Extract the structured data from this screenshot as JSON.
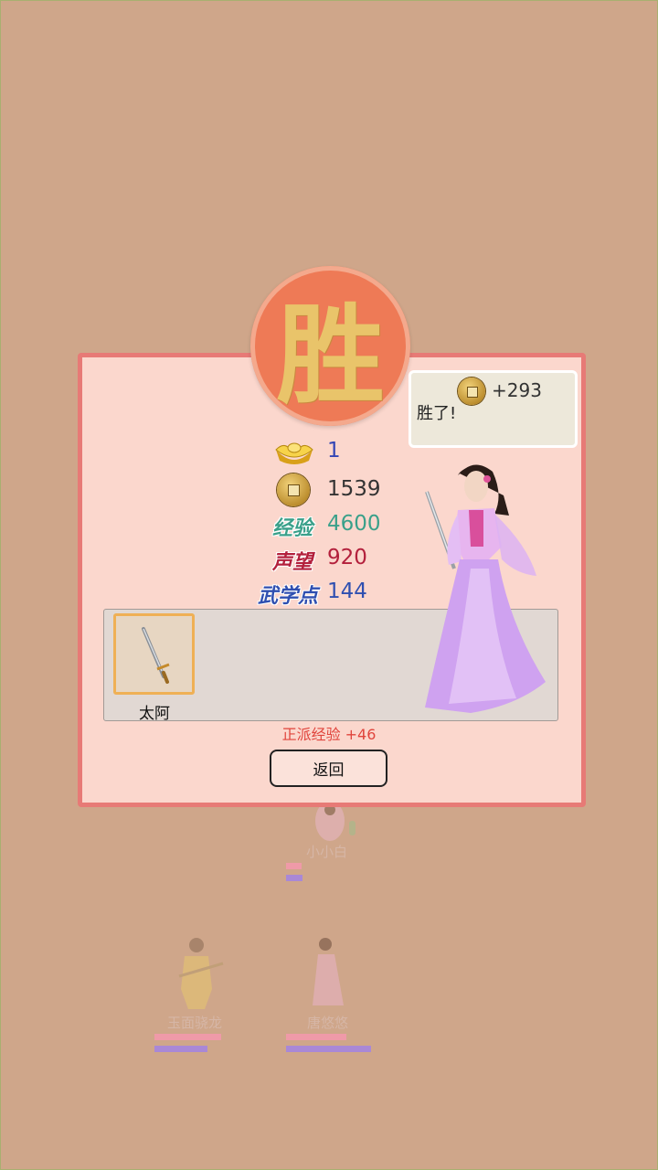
{
  "background_team": [
    {
      "name": "小小白"
    },
    {
      "name": "玉面骁龙"
    },
    {
      "name": "唐悠悠"
    }
  ],
  "result": {
    "badge": "胜",
    "bubble": {
      "coin_gain": "+293",
      "text": "胜了!"
    },
    "ingot_value": "1",
    "coins_value": "1539",
    "exp_label": "经验",
    "exp_value": "4600",
    "fame_label": "声望",
    "fame_value": "920",
    "martial_label": "武学点",
    "martial_value": "144",
    "item": {
      "name": "太阿",
      "icon": "sword-icon"
    },
    "faction_exp": "正派经验 +46",
    "back_label": "返回"
  },
  "colors": {
    "exp": "#3aa08a",
    "fame": "#b3203c",
    "martial": "#2f4fb0",
    "ingot_value": "#3346b5"
  }
}
